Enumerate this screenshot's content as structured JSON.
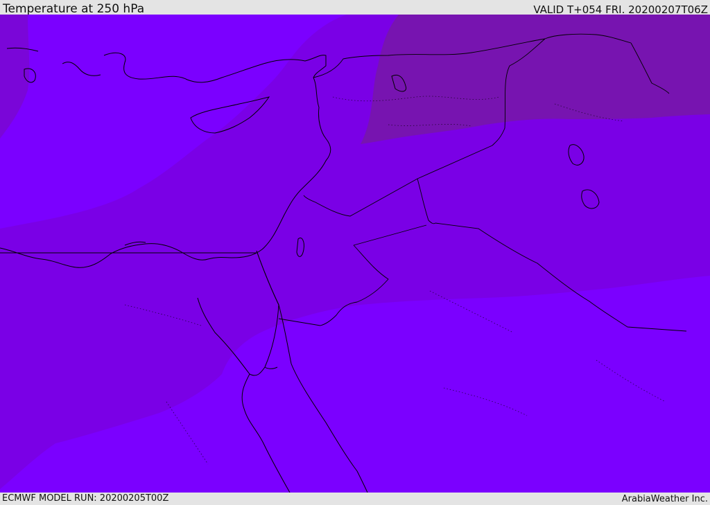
{
  "header": {
    "title": "Temperature at 250 hPa",
    "valid_time": "VALID T+054 FRI. 20200207T06Z"
  },
  "footer": {
    "model_run": "ECMWF MODEL RUN: 20200205T00Z",
    "credit": "ArabiaWeather Inc."
  },
  "map": {
    "region": "Eastern Mediterranean, Levant and northern Arabia",
    "colors": {
      "light_violet": "#7b00ff",
      "mid_violet": "#7a00e6",
      "dark_violet": "#7714b0",
      "coastline": "#000000"
    }
  }
}
